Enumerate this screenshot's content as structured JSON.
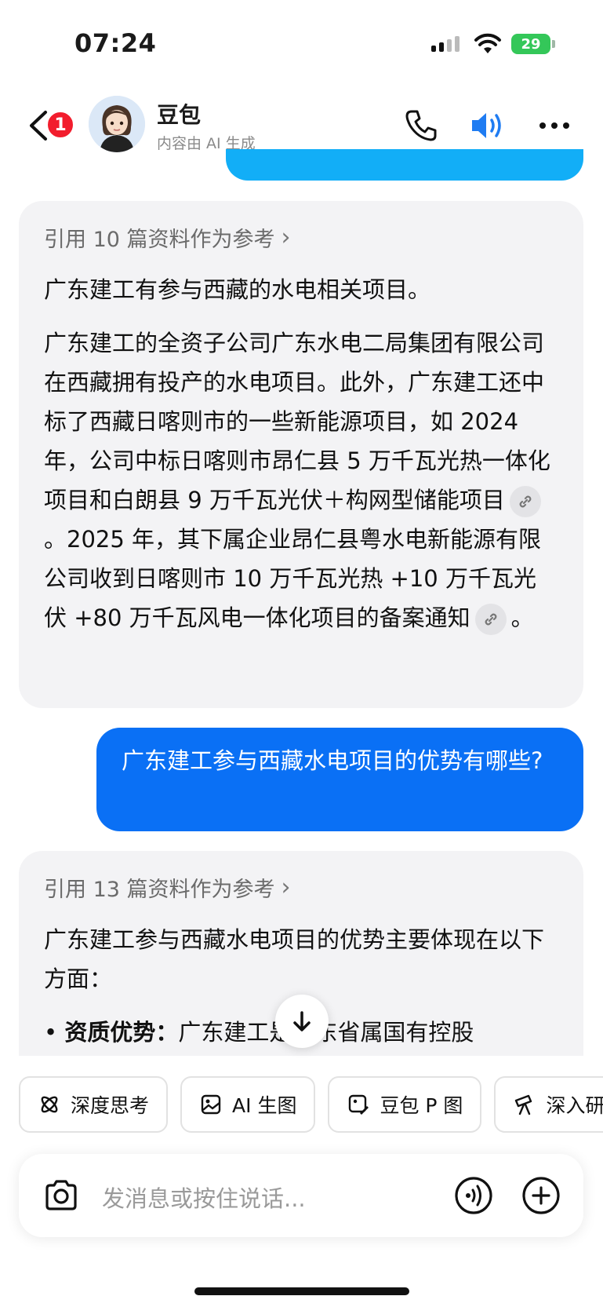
{
  "status_bar": {
    "time": "07:24",
    "battery": "29"
  },
  "header": {
    "unread_badge": "1",
    "bot_name": "豆包",
    "bot_subtitle": "内容由 AI 生成"
  },
  "messages": {
    "ai_1": {
      "reference": "引用 10 篇资料作为参考",
      "para1": "广东建工有参与西藏的水电相关项目。",
      "para2_a": "广东建工的全资子公司广东水电二局集团有限公司在西藏拥有投产的水电项目。此外，广东建工还中标了西藏日喀则市的一些新能源项目，如 2024 年，公司中标日喀则市昂仁县 5 万千瓦光热一体化项目和白朗县 9 万千瓦光伏＋构网型储能项目",
      "para2_b": "。2025 年，其下属企业昂仁县粤水电新能源有限公司收到日喀则市 10 万千瓦光热 +10 万千瓦光伏 +80 万千瓦风电一体化项目的备案通知",
      "para2_c": "。"
    },
    "user_1": {
      "text": "广东建工参与西藏水电项目的优势有哪些?"
    },
    "ai_2": {
      "reference": "引用 13 篇资料作为参考",
      "intro": "广东建工参与西藏水电项目的优势主要体现在以下方面：",
      "bullet_1_title": "资质优势：",
      "bullet_1_text": "广东建工是广东省属国有控股"
    }
  },
  "toolbar": {
    "chips": [
      {
        "label": "深度思考",
        "icon": "atom-icon"
      },
      {
        "label": "AI 生图",
        "icon": "image-icon"
      },
      {
        "label": "豆包 P 图",
        "icon": "photo-edit-icon"
      },
      {
        "label": "深入研",
        "icon": "telescope-icon"
      }
    ]
  },
  "input": {
    "placeholder": "发消息或按住说话..."
  },
  "colors": {
    "user_bubble": "#0a70f5",
    "accent": "#1f7cf2",
    "ai_bubble": "#f3f3f5",
    "badge": "#f21d2d"
  }
}
